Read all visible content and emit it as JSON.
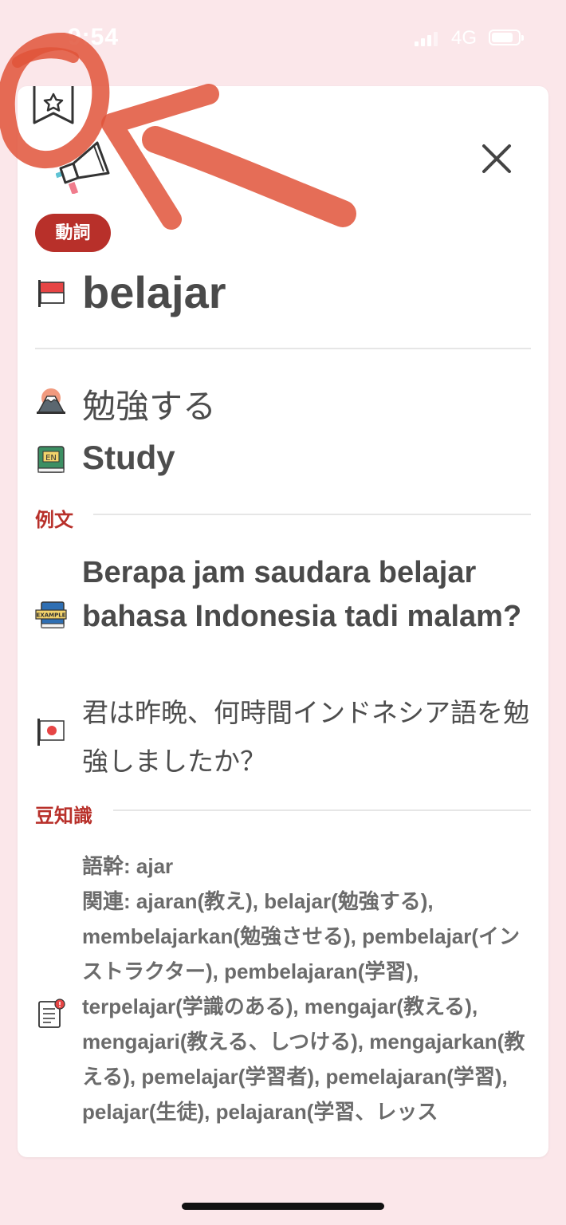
{
  "status_bar": {
    "time": "9:54",
    "network": "4G"
  },
  "card": {
    "part_of_speech": "動詞",
    "word": "belajar",
    "meaning_ja": "勉強する",
    "meaning_en": "Study",
    "example_section_label": "例文",
    "example_sentence": "Berapa jam saudara belajar bahasa Indonesia tadi malam?",
    "example_translation": "君は昨晩、何時間インドネシア語を勉強しましたか？",
    "trivia_section_label": "豆知識",
    "trivia_text": "語幹: ajar\n関連: ajaran(教え), belajar(勉強する), membelajarkan(勉強させる), pembelajar(インストラクター), pembelajaran(学習), terpelajar(学識のある), mengajar(教える), mengajari(教える、しつける), mengajarkan(教える), pemelajar(学習者), pemelajaran(学習), pelajar(生徒), pelajaran(学習、レッス"
  },
  "colors": {
    "background": "#fbe7ea",
    "accent": "#b8302a",
    "annotation": "#e0533a"
  },
  "icons": {
    "bookmark": "bookmark-star-icon",
    "speaker": "megaphone-icon",
    "close": "close-icon",
    "indonesia_flag": "indonesian-flag-icon",
    "japanese": "mount-fuji-icon",
    "english": "en-book-icon",
    "example": "example-book-icon",
    "japan_flag": "japanese-flag-icon",
    "trivia": "note-icon"
  }
}
